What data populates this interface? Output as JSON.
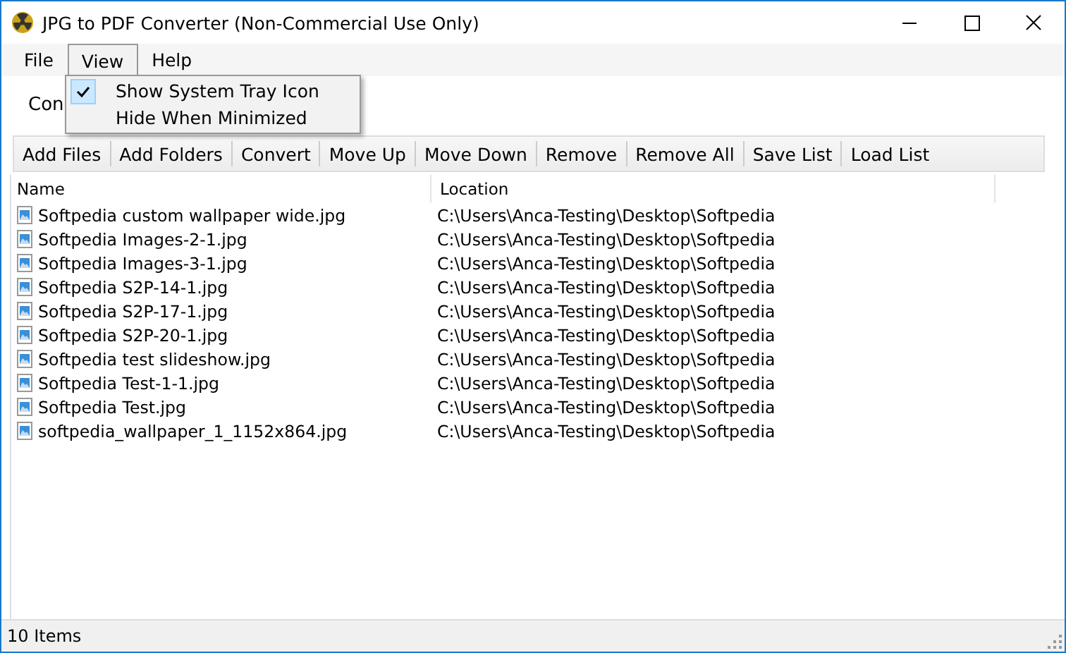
{
  "window": {
    "title": "JPG to PDF Converter (Non-Commercial Use Only)"
  },
  "menu": [
    {
      "label": "File",
      "selected": false
    },
    {
      "label": "View",
      "selected": true
    },
    {
      "label": "Help",
      "selected": false
    }
  ],
  "view_menu": {
    "items": [
      {
        "label": "Show System Tray Icon",
        "checked": true
      },
      {
        "label": "Hide When Minimized",
        "checked": false
      }
    ]
  },
  "tab": {
    "label": "Con"
  },
  "toolbar": [
    "Add Files",
    "Add Folders",
    "Convert",
    "Move Up",
    "Move Down",
    "Remove",
    "Remove All",
    "Save List",
    "Load List"
  ],
  "table": {
    "columns": [
      "Name",
      "Location"
    ],
    "rows": [
      {
        "name": "Softpedia custom wallpaper wide.jpg",
        "location": "C:\\Users\\Anca-Testing\\Desktop\\Softpedia"
      },
      {
        "name": "Softpedia Images-2-1.jpg",
        "location": "C:\\Users\\Anca-Testing\\Desktop\\Softpedia"
      },
      {
        "name": "Softpedia Images-3-1.jpg",
        "location": "C:\\Users\\Anca-Testing\\Desktop\\Softpedia"
      },
      {
        "name": "Softpedia S2P-14-1.jpg",
        "location": "C:\\Users\\Anca-Testing\\Desktop\\Softpedia"
      },
      {
        "name": "Softpedia S2P-17-1.jpg",
        "location": "C:\\Users\\Anca-Testing\\Desktop\\Softpedia"
      },
      {
        "name": "Softpedia S2P-20-1.jpg",
        "location": "C:\\Users\\Anca-Testing\\Desktop\\Softpedia"
      },
      {
        "name": "Softpedia test slideshow.jpg",
        "location": "C:\\Users\\Anca-Testing\\Desktop\\Softpedia"
      },
      {
        "name": "Softpedia Test-1-1.jpg",
        "location": "C:\\Users\\Anca-Testing\\Desktop\\Softpedia"
      },
      {
        "name": "Softpedia Test.jpg",
        "location": "C:\\Users\\Anca-Testing\\Desktop\\Softpedia"
      },
      {
        "name": "softpedia_wallpaper_1_1152x864.jpg",
        "location": "C:\\Users\\Anca-Testing\\Desktop\\Softpedia"
      }
    ]
  },
  "status_bar": {
    "text": "10 Items"
  }
}
